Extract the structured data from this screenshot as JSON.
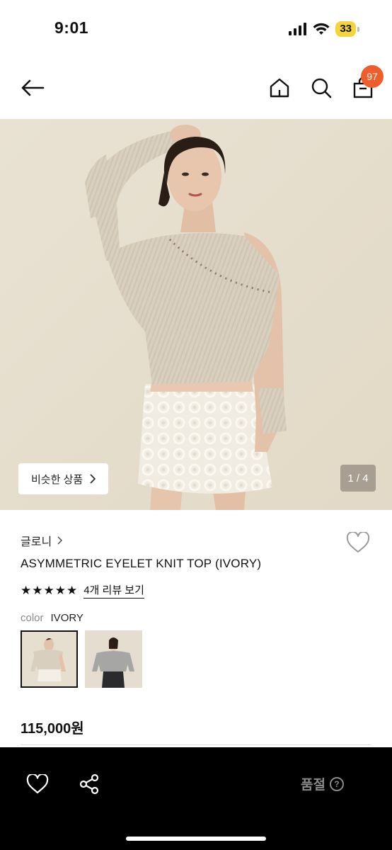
{
  "status": {
    "time": "9:01",
    "battery": "33"
  },
  "nav": {
    "cart_count": "97"
  },
  "hero": {
    "similar_label": "비슷한 상품",
    "page_counter": "1 / 4"
  },
  "product": {
    "brand": "글로니",
    "name": "ASYMMETRIC EYELET KNIT TOP (IVORY)",
    "stars": "★★★★★",
    "review_link": "4개 리뷰 보기",
    "color_label": "color",
    "color_value": "IVORY",
    "price": "115,000원"
  },
  "bottom": {
    "status_label": "품절",
    "help_label": "?"
  },
  "colors": {
    "accent": "#ef5d2a",
    "battery": "#f5d33a",
    "bottom_bar": "#000000"
  }
}
